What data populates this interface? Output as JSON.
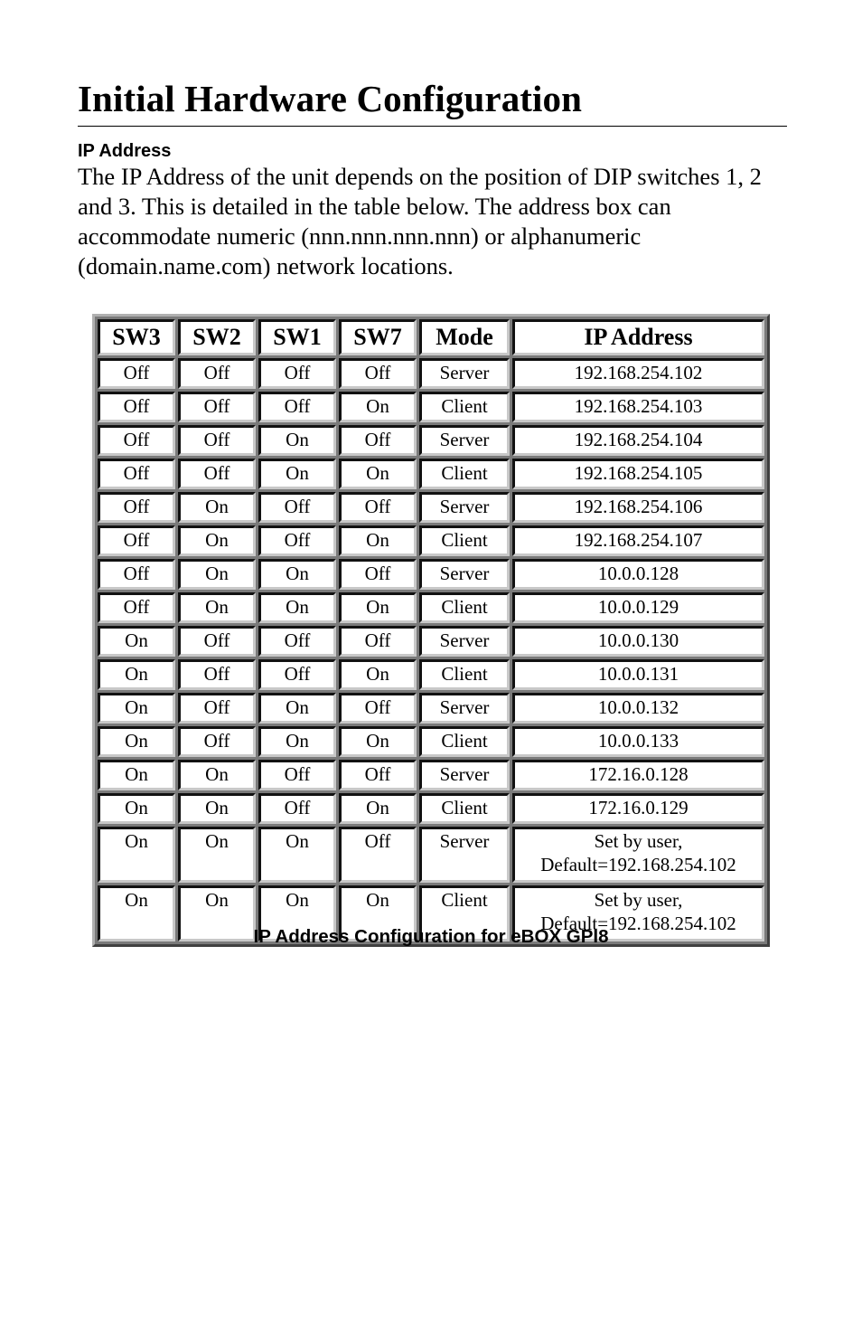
{
  "document": {
    "title": "Initial Hardware Configuration",
    "section_heading": "IP Address",
    "intro_paragraph": "The IP Address of the unit depends on the position of DIP switches 1, 2 and 3.  This is detailed in the table below.  The address box can accommodate numeric (nnn.nnn.nnn.nnn) or alphanumeric (domain.name.com) network locations.",
    "table": {
      "headers": [
        "SW3",
        "SW2",
        "SW1",
        "SW7",
        "Mode",
        "IP Address"
      ],
      "rows": [
        {
          "sw3": "Off",
          "sw2": "Off",
          "sw1": "Off",
          "sw7": "Off",
          "mode": "Server",
          "ip": [
            "192.168.254.102"
          ]
        },
        {
          "sw3": "Off",
          "sw2": "Off",
          "sw1": "Off",
          "sw7": "On",
          "mode": "Client",
          "ip": [
            "192.168.254.103"
          ]
        },
        {
          "sw3": "Off",
          "sw2": "Off",
          "sw1": "On",
          "sw7": "Off",
          "mode": "Server",
          "ip": [
            "192.168.254.104"
          ]
        },
        {
          "sw3": "Off",
          "sw2": "Off",
          "sw1": "On",
          "sw7": "On",
          "mode": "Client",
          "ip": [
            "192.168.254.105"
          ]
        },
        {
          "sw3": "Off",
          "sw2": "On",
          "sw1": "Off",
          "sw7": "Off",
          "mode": "Server",
          "ip": [
            "192.168.254.106"
          ]
        },
        {
          "sw3": "Off",
          "sw2": "On",
          "sw1": "Off",
          "sw7": "On",
          "mode": "Client",
          "ip": [
            "192.168.254.107"
          ]
        },
        {
          "sw3": "Off",
          "sw2": "On",
          "sw1": "On",
          "sw7": "Off",
          "mode": "Server",
          "ip": [
            "10.0.0.128"
          ]
        },
        {
          "sw3": "Off",
          "sw2": "On",
          "sw1": "On",
          "sw7": "On",
          "mode": "Client",
          "ip": [
            "10.0.0.129"
          ]
        },
        {
          "sw3": "On",
          "sw2": "Off",
          "sw1": "Off",
          "sw7": "Off",
          "mode": "Server",
          "ip": [
            "10.0.0.130"
          ]
        },
        {
          "sw3": "On",
          "sw2": "Off",
          "sw1": "Off",
          "sw7": "On",
          "mode": "Client",
          "ip": [
            "10.0.0.131"
          ]
        },
        {
          "sw3": "On",
          "sw2": "Off",
          "sw1": "On",
          "sw7": "Off",
          "mode": "Server",
          "ip": [
            "10.0.0.132"
          ]
        },
        {
          "sw3": "On",
          "sw2": "Off",
          "sw1": "On",
          "sw7": "On",
          "mode": "Client",
          "ip": [
            "10.0.0.133"
          ]
        },
        {
          "sw3": "On",
          "sw2": "On",
          "sw1": "Off",
          "sw7": "Off",
          "mode": "Server",
          "ip": [
            "172.16.0.128"
          ]
        },
        {
          "sw3": "On",
          "sw2": "On",
          "sw1": "Off",
          "sw7": "On",
          "mode": "Client",
          "ip": [
            "172.16.0.129"
          ]
        },
        {
          "sw3": "On",
          "sw2": "On",
          "sw1": "On",
          "sw7": "Off",
          "mode": "Server",
          "ip": [
            "Set by user,",
            "Default=192.168.254.102"
          ]
        },
        {
          "sw3": "On",
          "sw2": "On",
          "sw1": "On",
          "sw7": "On",
          "mode": "Client",
          "ip": [
            "Set by user,",
            "Default=192.168.254.102"
          ]
        }
      ]
    },
    "caption": "IP Address Configuration for eBOX GPI8"
  }
}
